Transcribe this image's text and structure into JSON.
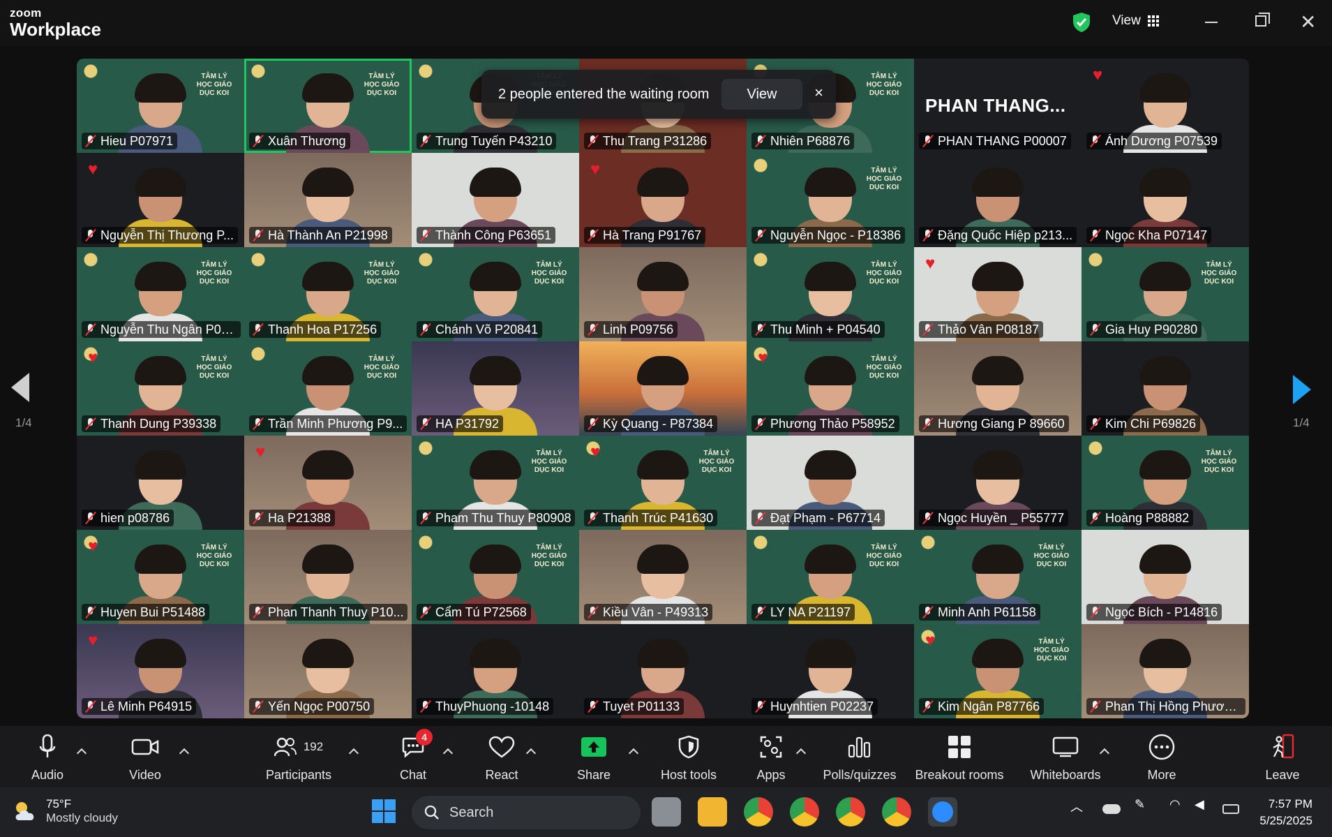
{
  "app": {
    "logo_small": "zoom",
    "logo_big": "Workplace",
    "view_label": "View"
  },
  "toast": {
    "message": "2 people entered the waiting room",
    "view_label": "View",
    "close": "×"
  },
  "pagination": {
    "left": "1/4",
    "right": "1/4"
  },
  "tile_brand": "TÂM LÝ HỌC GIÁO DỤC KOI",
  "participants": [
    {
      "name": "Hieu P07971",
      "bg": "green"
    },
    {
      "name": "Xuân Thương",
      "bg": "green",
      "active": true
    },
    {
      "name": "Trung Tuyến P43210",
      "bg": "green"
    },
    {
      "name": "Thu Trang P31286",
      "bg": "red"
    },
    {
      "name": "Nhiên P68876",
      "bg": "green"
    },
    {
      "name": "PHAN THANG P00007",
      "bg": "dark",
      "big_text": "PHAN  THANG..."
    },
    {
      "name": "Ánh Dương P07539",
      "bg": "dark",
      "heart": true
    },
    {
      "name": "Nguyễn Thị Thương P...",
      "bg": "dark",
      "heart": true
    },
    {
      "name": "Hà Thành An P21998",
      "bg": "room"
    },
    {
      "name": "Thành Công P63651",
      "bg": "light"
    },
    {
      "name": "Hà Trang P91767",
      "bg": "red",
      "heart": true
    },
    {
      "name": "Nguyễn Ngọc - P18386",
      "bg": "green"
    },
    {
      "name": "Đặng Quốc Hiệp p213...",
      "bg": "dark"
    },
    {
      "name": "Ngọc Kha P07147",
      "bg": "dark"
    },
    {
      "name": "Nguyễn Thu Ngân P01...",
      "bg": "green"
    },
    {
      "name": "Thanh Hoa P17256",
      "bg": "green"
    },
    {
      "name": "Chánh Võ P20841",
      "bg": "green"
    },
    {
      "name": "Linh P09756",
      "bg": "room"
    },
    {
      "name": "Thu Minh + P04540",
      "bg": "green"
    },
    {
      "name": "Thảo Vân P08187",
      "bg": "light",
      "heart": true
    },
    {
      "name": "Gia Huy P90280",
      "bg": "green"
    },
    {
      "name": "Thanh Dung P39338",
      "bg": "green",
      "heart": true
    },
    {
      "name": "Trần Minh Phương P9...",
      "bg": "green"
    },
    {
      "name": "HA P31792",
      "bg": "purple"
    },
    {
      "name": "Kỳ Quang - P87384",
      "bg": "sunset"
    },
    {
      "name": "Phương Thảo P58952",
      "bg": "green",
      "heart": true
    },
    {
      "name": "Hương Giang P 89660",
      "bg": "room"
    },
    {
      "name": "Kim Chi P69826",
      "bg": "dark"
    },
    {
      "name": "hien p08786",
      "bg": "dark"
    },
    {
      "name": "Ha P21388",
      "bg": "room",
      "heart": true
    },
    {
      "name": "Pham Thu Thuy P80908",
      "bg": "green"
    },
    {
      "name": "Thanh Trúc P41630",
      "bg": "green",
      "heart": true
    },
    {
      "name": "Đạt Phạm - P67714",
      "bg": "light"
    },
    {
      "name": "Ngọc Huyền _ P55777",
      "bg": "dark"
    },
    {
      "name": "Hoàng P88882",
      "bg": "green"
    },
    {
      "name": "Huyen Bui P51488",
      "bg": "green",
      "heart": true
    },
    {
      "name": "Phan Thanh Thuy P10...",
      "bg": "room"
    },
    {
      "name": "Cẩm Tú P72568",
      "bg": "green"
    },
    {
      "name": "Kiều Vân - P49313",
      "bg": "room"
    },
    {
      "name": "LY NA P21197",
      "bg": "green"
    },
    {
      "name": "Minh Anh P61158",
      "bg": "green"
    },
    {
      "name": "Ngọc Bích - P14816",
      "bg": "light"
    },
    {
      "name": "Lê Minh P64915",
      "bg": "purple",
      "heart": true
    },
    {
      "name": "Yến Ngọc P00750",
      "bg": "room"
    },
    {
      "name": "ThuyPhuong -10148",
      "bg": "dark"
    },
    {
      "name": "Tuyet P01133",
      "bg": "dark"
    },
    {
      "name": "Huynhtien P02237",
      "bg": "dark"
    },
    {
      "name": "Kim Ngân P87766",
      "bg": "green",
      "heart": true
    },
    {
      "name": "Phan Thị Hồng Phươn...",
      "bg": "room"
    }
  ],
  "toolbar": {
    "audio": "Audio",
    "video": "Video",
    "participants": "Participants",
    "participants_count": "192",
    "chat": "Chat",
    "chat_badge": "4",
    "react": "React",
    "share": "Share",
    "host_tools": "Host tools",
    "apps": "Apps",
    "polls": "Polls/quizzes",
    "breakout": "Breakout rooms",
    "whiteboards": "Whiteboards",
    "more": "More",
    "leave": "Leave"
  },
  "taskbar": {
    "temp": "75°F",
    "weather": "Mostly cloudy",
    "search": "Search",
    "time": "7:57 PM",
    "date": "5/25/2025"
  },
  "colors": {
    "accent_green": "#22c55e",
    "share_green": "#16c45b",
    "leave_red": "#e7262f",
    "nav_blue": "#1da1f2"
  }
}
